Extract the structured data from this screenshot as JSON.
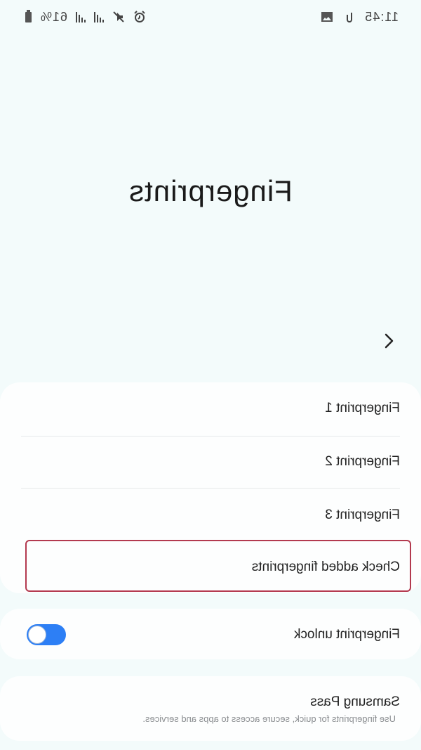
{
  "status_bar": {
    "time": "11:45",
    "battery": "61%",
    "icons": [
      "battery-icon",
      "signal-icon",
      "signal-icon",
      "mute-icon",
      "alarm-icon",
      "image-icon",
      "link-icon"
    ]
  },
  "page": {
    "title": "Fingerprints"
  },
  "fingerprint_list": {
    "items": [
      {
        "label": "Fingerprint 1"
      },
      {
        "label": "Fingerprint 2"
      },
      {
        "label": "Fingerprint 3"
      },
      {
        "label": "Check added fingerprints"
      }
    ]
  },
  "fingerprint_unlock": {
    "label": "Fingerprint unlock",
    "enabled": true
  },
  "samsung_pass": {
    "title": "Samsung Pass",
    "description": "Use fingerprints for quick, secure access to apps and services."
  },
  "colors": {
    "background": "#f3fbfb",
    "card": "#fdfefe",
    "toggle_on": "#2d7ff5",
    "highlight": "#b33a4f"
  }
}
